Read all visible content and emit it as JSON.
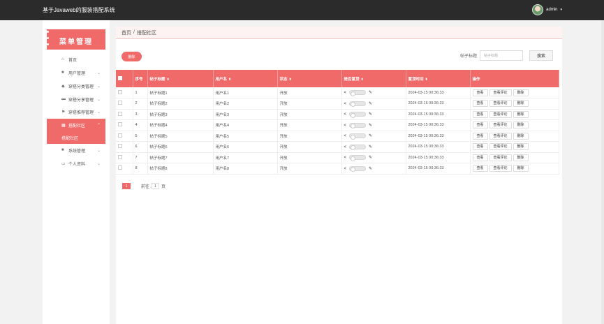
{
  "app": {
    "title": "基于Javaweb的服装搭配系统"
  },
  "user": {
    "name": "admin",
    "caret": "▾"
  },
  "sidebar": {
    "title": "菜单管理",
    "items": [
      {
        "label": "首页",
        "icon": "⌂",
        "arrow": ""
      },
      {
        "label": "用户管理",
        "icon": "■",
        "arrow": "⌄"
      },
      {
        "label": "穿搭分类管理",
        "icon": "◆",
        "arrow": "⌄"
      },
      {
        "label": "穿搭分享管理",
        "icon": "▬",
        "arrow": "⌄"
      },
      {
        "label": "穿搭推荐管理",
        "icon": "⚑",
        "arrow": "⌄"
      },
      {
        "label": "搭配社区",
        "icon": "▦",
        "arrow": "⌃"
      },
      {
        "label": "系统管理",
        "icon": "■",
        "arrow": "⌄"
      },
      {
        "label": "个人资料",
        "icon": "▭",
        "arrow": "⌄"
      }
    ],
    "active_sub": "搭配社区"
  },
  "breadcrumb": {
    "home": "首页",
    "sep": "/",
    "current": "搭配社区"
  },
  "toolbar": {
    "delete_label": "删除",
    "search_label": "帖子标题",
    "search_placeholder": "帖子标题",
    "search_button": "搜索"
  },
  "table": {
    "headers": [
      "序号",
      "帖子标题",
      "用户名",
      "状态",
      "是否置顶",
      "置顶时间",
      "操作"
    ],
    "sort_icon": "⬍",
    "rows": [
      {
        "no": "1",
        "title": "帖子标题1",
        "user": "用户名1",
        "status": "开放",
        "time": "2024-03-15 00:36:33"
      },
      {
        "no": "2",
        "title": "帖子标题2",
        "user": "用户名2",
        "status": "开放",
        "time": "2024-03-15 00:36:33"
      },
      {
        "no": "3",
        "title": "帖子标题3",
        "user": "用户名3",
        "status": "开放",
        "time": "2024-03-15 00:36:33"
      },
      {
        "no": "4",
        "title": "帖子标题4",
        "user": "用户名4",
        "status": "开放",
        "time": "2024-03-15 00:36:33"
      },
      {
        "no": "5",
        "title": "帖子标题5",
        "user": "用户名5",
        "status": "开放",
        "time": "2024-03-15 00:36:33"
      },
      {
        "no": "6",
        "title": "帖子标题6",
        "user": "用户名6",
        "status": "开放",
        "time": "2024-03-15 00:36:33"
      },
      {
        "no": "7",
        "title": "帖子标题7",
        "user": "用户名7",
        "status": "开放",
        "time": "2024-03-15 00:36:33"
      },
      {
        "no": "8",
        "title": "帖子标题8",
        "user": "用户名8",
        "status": "开放",
        "time": "2024-03-15 00:36:33"
      }
    ],
    "pin_toggle_on": false,
    "actions": [
      "查看",
      "查看评论",
      "删除"
    ]
  },
  "pagination": {
    "current": "1",
    "goto_prefix": "前往",
    "goto_value": "1",
    "goto_suffix": "页"
  },
  "colors": {
    "accent": "#f06a6a",
    "topbar": "#2b2b2b"
  }
}
